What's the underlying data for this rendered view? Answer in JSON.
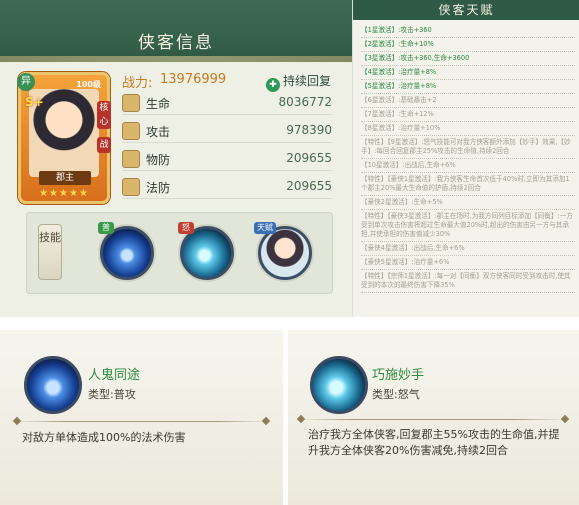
{
  "hero_panel": {
    "title": "侠客信息",
    "card": {
      "level": "100级",
      "grade": "S+",
      "faction_tag": "异",
      "side_tag_1": "核心",
      "side_tag_2": "战",
      "name": "郡主",
      "stars": "★★★★★"
    },
    "power_label": "战力:",
    "power_value": "13976999",
    "regen_label": "持续回复",
    "stats": [
      {
        "label": "生命",
        "value": "8036772"
      },
      {
        "label": "攻击",
        "value": "978390"
      },
      {
        "label": "物防",
        "value": "209655"
      },
      {
        "label": "法防",
        "value": "209655"
      }
    ],
    "skill_button_label": "技能",
    "skill_tags": [
      "普",
      "怒",
      "天赋"
    ]
  },
  "talent_panel": {
    "title": "侠客天赋",
    "rows": [
      {
        "text": "【1星激活】:攻击+360",
        "state": "on"
      },
      {
        "text": "【2星激活】:生命+10%",
        "state": "on"
      },
      {
        "text": "【3星激活】:攻击+360,生命+3600",
        "state": "on"
      },
      {
        "text": "【4星激活】:治疗量+8%",
        "state": "on"
      },
      {
        "text": "【5星激活】:治疗量+8%",
        "state": "on"
      },
      {
        "text": "【6星激活】:基础暴击+2",
        "state": "off"
      },
      {
        "text": "【7星激活】:生命+12%",
        "state": "off"
      },
      {
        "text": "【8星激活】:治疗量+10%",
        "state": "off"
      },
      {
        "text": "【特性】【9星激活】:怒气技能可对我方侠客额外添加【妙手】效果,【妙手】:每回合回复郡主25%攻击的生命值,持续2回合",
        "state": "off"
      },
      {
        "text": "【10星激活】:出战后,生命+6%",
        "state": "off"
      },
      {
        "text": "【特性】【豪侠1星激活】:我方侠客生命首次低于40%时,立即为其添加1个郡主20%最大生命值的护盾,持续2回合",
        "state": "off"
      },
      {
        "text": "【豪侠2星激活】:生命+5%",
        "state": "off"
      },
      {
        "text": "【特性】【豪侠3星激活】:郡主在场时,为我方同列目标添加【同衡】:一方受到单次攻击伤害将超过生命最大值20%时,超出的伤害由另一方与其承担,并使承担的伤害值减少30%",
        "state": "off"
      },
      {
        "text": "【豪侠4星激活】:出战后,生命+6%",
        "state": "off"
      },
      {
        "text": "【豪侠5星激活】:治疗量+6%",
        "state": "off"
      },
      {
        "text": "【特性】【宗师1星激活】:每一对【同衡】双方侠客同时受到攻击时,使其受到的本次的最终伤害下降35%",
        "state": "off"
      }
    ]
  },
  "skill_cards": [
    {
      "name": "人鬼同途",
      "type_label": "类型:普攻",
      "desc": "对敌方单体造成100%的法术伤害"
    },
    {
      "name": "巧施妙手",
      "type_label": "类型:怒气",
      "desc": "治疗我方全体侠客,回复郡主55%攻击的生命值,并提升我方全体侠客20%伤害减免,持续2回合"
    }
  ],
  "colors": {
    "header_green": "#356049",
    "power_orange": "#c97a1c",
    "skill_name_green": "#2f8a3f"
  }
}
